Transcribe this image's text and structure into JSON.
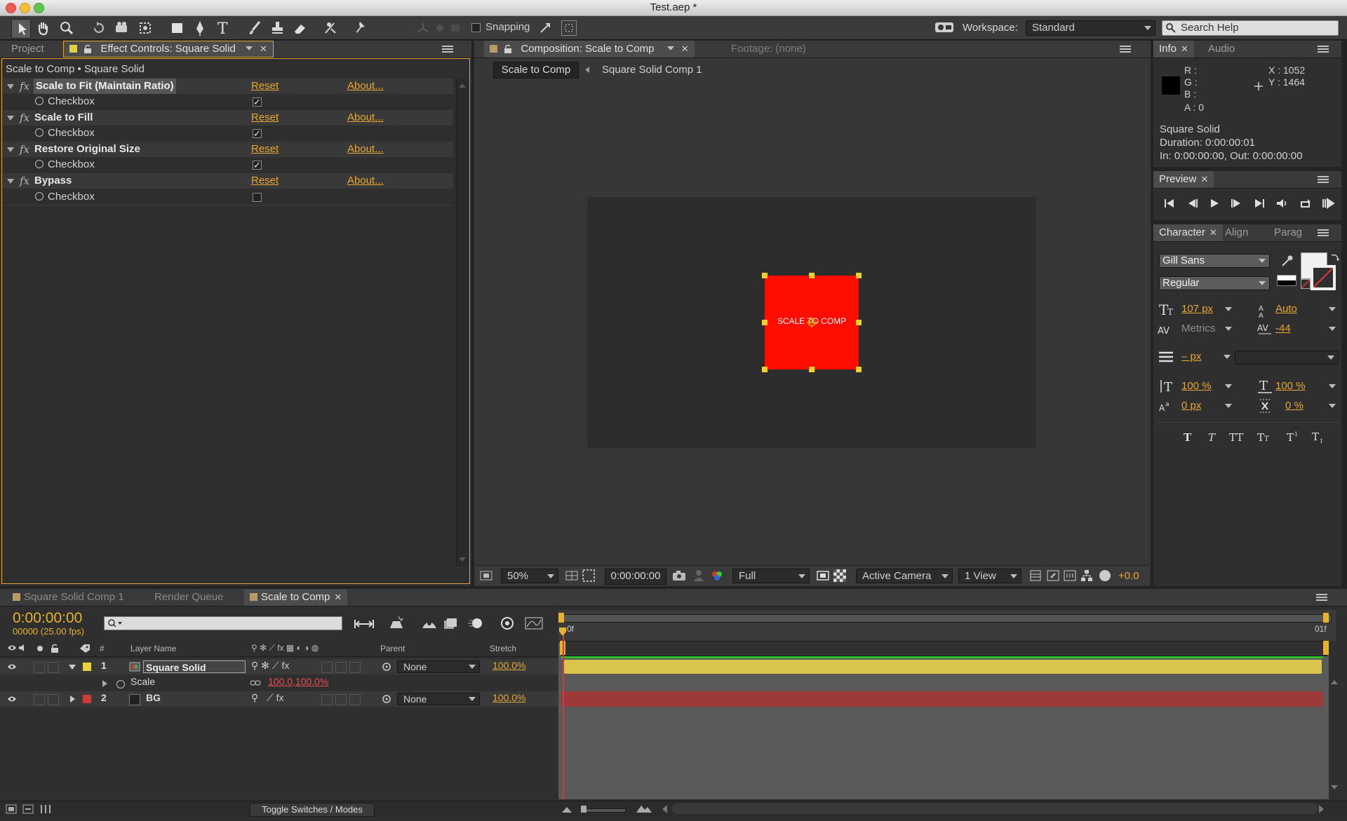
{
  "app": {
    "window_title": "Test.aep *"
  },
  "toolbar": {
    "snapping_label": "Snapping",
    "workspace_label": "Workspace:",
    "workspace_value": "Standard",
    "search_placeholder": "Search Help"
  },
  "project_panel": {
    "tabs": [
      {
        "label": "Project"
      },
      {
        "label": "Effect Controls: Square Solid"
      }
    ],
    "breadcrumb": "Scale to Comp • Square Solid",
    "effects": [
      {
        "name": "Scale to Fit (Maintain Ratio)",
        "reset": "Reset",
        "about": "About...",
        "param": "Checkbox",
        "checked": true
      },
      {
        "name": "Scale to Fill",
        "reset": "Reset",
        "about": "About...",
        "param": "Checkbox",
        "checked": true
      },
      {
        "name": "Restore Original Size",
        "reset": "Reset",
        "about": "About...",
        "param": "Checkbox",
        "checked": true
      },
      {
        "name": "Bypass",
        "reset": "Reset",
        "about": "About...",
        "param": "Checkbox",
        "checked": false
      }
    ]
  },
  "composition_panel": {
    "tabs": [
      {
        "label": "Composition: Scale to Comp"
      },
      {
        "label": "Footage: (none)"
      }
    ],
    "flow": [
      "Scale to Comp",
      "Square Solid Comp 1"
    ],
    "layer_text": "SCALE TO COMP",
    "footer": {
      "zoom": "50%",
      "timecode": "0:00:00:00",
      "resolution": "Full",
      "camera": "Active Camera",
      "views": "1 View",
      "exposure": "+0.0"
    }
  },
  "info_panel": {
    "tabs": [
      {
        "label": "Info"
      },
      {
        "label": "Audio"
      }
    ],
    "r_label": "R :",
    "g_label": "G :",
    "b_label": "B :",
    "a_label": "A : 0",
    "x_value": "X : 1052",
    "y_value": "Y : 1464",
    "layer_name": "Square Solid",
    "duration": "Duration: 0:00:00:01",
    "in_out": "In: 0:00:00:00, Out: 0:00:00:00"
  },
  "preview_panel": {
    "tabs": [
      {
        "label": "Preview"
      }
    ]
  },
  "character_panel": {
    "tabs": [
      {
        "label": "Character"
      },
      {
        "label": "Align"
      },
      {
        "label": "Parag"
      }
    ],
    "font": "Gill Sans",
    "style": "Regular",
    "size": "107 px",
    "leading": "Auto",
    "kerning": "Metrics",
    "tracking": "-44",
    "stroke_width": "– px",
    "v_scale": "100 %",
    "h_scale": "100 %",
    "baseline": "0 px",
    "tsume": "0 %"
  },
  "timeline": {
    "tabs": [
      {
        "label": "Square Solid Comp 1"
      },
      {
        "label": "Render Queue"
      },
      {
        "label": "Scale to Comp"
      }
    ],
    "timecode": "0:00:00:00",
    "fps": "00000 (25.00 fps)",
    "headers": {
      "layer_name": "Layer Name",
      "hash": "#",
      "parent": "Parent",
      "stretch": "Stretch"
    },
    "layers": [
      {
        "num": "1",
        "name": "Square Solid",
        "parent": "None",
        "stretch": "100.0%",
        "color": "#e9d23b"
      },
      {
        "num": "2",
        "name": "BG",
        "parent": "None",
        "stretch": "100.0%",
        "color": "#d23a3a"
      }
    ],
    "scale_prop": {
      "label": "Scale",
      "value": "100.0,100.0%"
    },
    "ruler_start": "0f",
    "ruler_end": "01f",
    "footer_toggle": "Toggle Switches / Modes"
  }
}
